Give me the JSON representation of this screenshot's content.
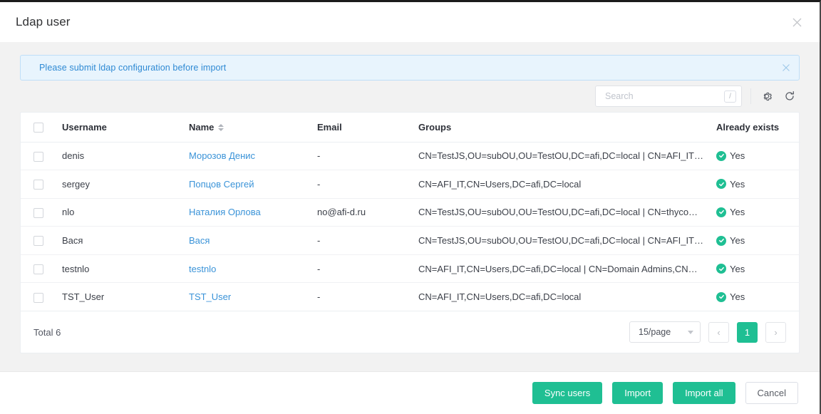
{
  "dialog": {
    "title": "Ldap user",
    "close_icon": "close-icon"
  },
  "alert": {
    "message": "Please submit ldap configuration before import",
    "close_icon": "close-icon",
    "bg_color": "#e8f4fd",
    "text_color": "#2f8ad4"
  },
  "toolbar": {
    "search_placeholder": "Search",
    "search_value": "",
    "search_shortcut": "/",
    "settings_icon": "gear-icon",
    "refresh_icon": "refresh-icon"
  },
  "table": {
    "columns": [
      {
        "key": "checkbox",
        "label": ""
      },
      {
        "key": "username",
        "label": "Username"
      },
      {
        "key": "name",
        "label": "Name",
        "sortable": true
      },
      {
        "key": "email",
        "label": "Email"
      },
      {
        "key": "groups",
        "label": "Groups"
      },
      {
        "key": "exists",
        "label": "Already exists"
      }
    ],
    "rows": [
      {
        "username": "denis",
        "name": "Морозов Денис",
        "email": "-",
        "groups": "CN=TestJS,OU=subOU,OU=TestOU,DC=afi,DC=local | CN=AFI_IT…",
        "exists": "Yes"
      },
      {
        "username": "sergey",
        "name": "Попцов Сергей",
        "email": "-",
        "groups": "CN=AFI_IT,CN=Users,DC=afi,DC=local",
        "exists": "Yes"
      },
      {
        "username": "nlo",
        "name": "Наталия Орлова",
        "email": "no@afi-d.ru",
        "groups": "CN=TestJS,OU=subOU,OU=TestOU,DC=afi,DC=local | CN=thyco…",
        "exists": "Yes"
      },
      {
        "username": "Вася",
        "name": "Вася",
        "email": "-",
        "groups": "CN=TestJS,OU=subOU,OU=TestOU,DC=afi,DC=local | CN=AFI_IT…",
        "exists": "Yes"
      },
      {
        "username": "testnlo",
        "name": "testnlo",
        "email": "-",
        "groups": "CN=AFI_IT,CN=Users,DC=afi,DC=local | CN=Domain Admins,CN…",
        "exists": "Yes"
      },
      {
        "username": "TST_User",
        "name": "TST_User",
        "email": "-",
        "groups": "CN=AFI_IT,CN=Users,DC=afi,DC=local",
        "exists": "Yes"
      }
    ]
  },
  "pagination": {
    "total_text": "Total 6",
    "page_size": "15/page",
    "prev_label": "‹",
    "next_label": "›",
    "current_page": "1"
  },
  "footer": {
    "sync_users": "Sync users",
    "import": "Import",
    "import_all": "Import all",
    "cancel": "Cancel"
  },
  "colors": {
    "accent": "#1fbf93",
    "link": "#3a93d8",
    "info": "#2f8ad4"
  }
}
